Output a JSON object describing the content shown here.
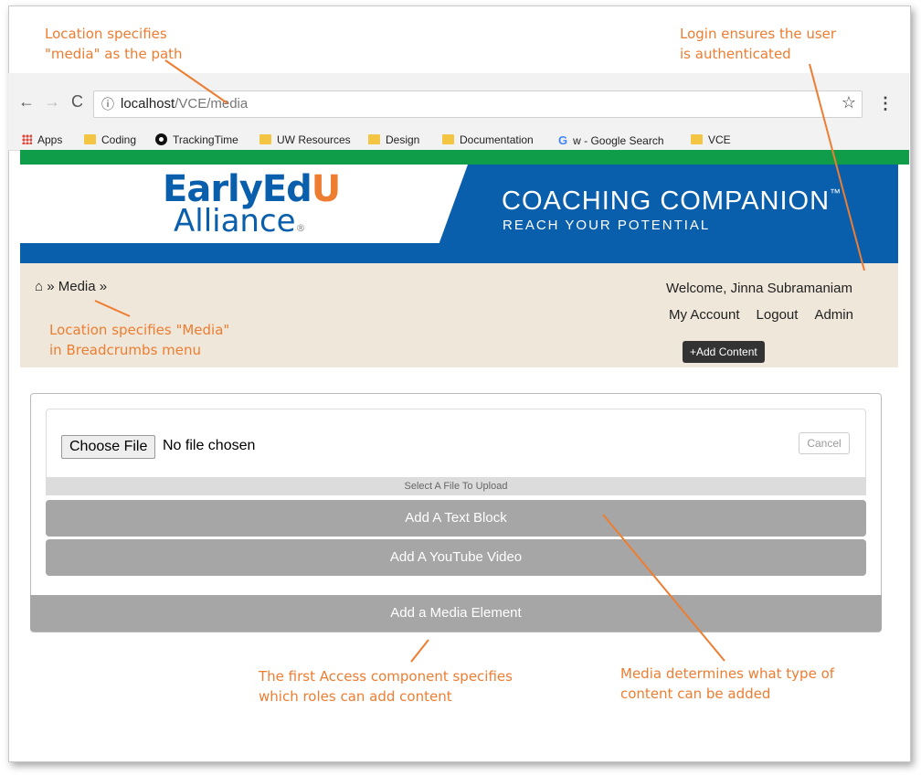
{
  "annotations": {
    "location_path_line1": "Location specifies",
    "location_path_line2": "\"media\" as the path",
    "login_line1": "Login ensures the user",
    "login_line2": "is authenticated",
    "breadcrumb_line1": "Location specifies \"Media\"",
    "breadcrumb_line2": "in Breadcrumbs menu",
    "access_line1": "The first Access component specifies",
    "access_line2": "which roles can add content",
    "media_line1": "Media determines what type of",
    "media_line2": "content can be added",
    "color": "#ed7d31"
  },
  "browser": {
    "url_host": "localhost",
    "url_path": "/VCE/media",
    "bookmarks": [
      {
        "label": "Apps",
        "icon": "apps-grid-icon"
      },
      {
        "label": "Coding",
        "icon": "folder-icon"
      },
      {
        "label": "TrackingTime",
        "icon": "trackingtime-icon"
      },
      {
        "label": "UW Resources",
        "icon": "folder-icon"
      },
      {
        "label": "Design",
        "icon": "folder-icon"
      },
      {
        "label": "Documentation",
        "icon": "folder-icon"
      },
      {
        "label": "w - Google Search",
        "icon": "google-icon"
      },
      {
        "label": "VCE",
        "icon": "folder-icon"
      }
    ]
  },
  "site": {
    "logo_line1_a": "EarlyEd",
    "logo_line1_b": "U",
    "logo_line2": "Alliance",
    "logo_reg": "®",
    "title": "COACHING COMPANION",
    "title_tm": "™",
    "subtitle": "REACH YOUR POTENTIAL",
    "brand_blue": "#0a5fad",
    "brand_green": "#0f9d4a"
  },
  "breadcrumb": {
    "home_symbol": "⌂",
    "separator": "»",
    "current": "Media"
  },
  "user": {
    "welcome": "Welcome, Jinna Subramaniam",
    "my_account": "My Account",
    "logout": "Logout",
    "admin": "Admin",
    "add_content": "+Add Content"
  },
  "media_panel": {
    "choose_file": "Choose File",
    "no_file": "No file chosen",
    "cancel": "Cancel",
    "select_hint": "Select A File To Upload",
    "add_text_block": "Add A Text Block",
    "add_youtube": "Add A YouTube Video",
    "add_media_element": "Add a Media Element"
  }
}
